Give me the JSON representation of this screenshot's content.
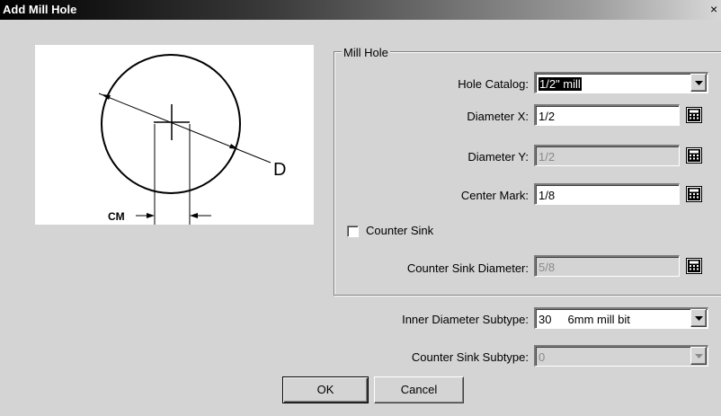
{
  "dialog": {
    "title": "Add Mill Hole",
    "close_glyph": "×"
  },
  "illustration": {
    "diameter_label": "D",
    "center_mark_label": "CM"
  },
  "mill_hole_group": {
    "legend": "Mill Hole",
    "hole_catalog": {
      "label": "Hole Catalog:",
      "value": "1/2\" mill"
    },
    "diameter_x": {
      "label": "Diameter X:",
      "value": "1/2"
    },
    "diameter_y": {
      "label": "Diameter Y:",
      "value": "1/2"
    },
    "center_mark": {
      "label": "Center Mark:",
      "value": "1/8"
    },
    "counter_sink": {
      "label": "Counter Sink",
      "checked": false
    },
    "counter_sink_diameter": {
      "label": "Counter Sink Diameter:",
      "value": "5/8"
    }
  },
  "inner_diameter_subtype": {
    "label": "Inner Diameter Subtype:",
    "value": "30     6mm mill bit"
  },
  "counter_sink_subtype": {
    "label": "Counter Sink Subtype:",
    "value": "0"
  },
  "buttons": {
    "ok": "OK",
    "cancel": "Cancel"
  },
  "icons": {
    "calculator": "calculator-icon",
    "dropdown": "chevron-down-icon"
  }
}
